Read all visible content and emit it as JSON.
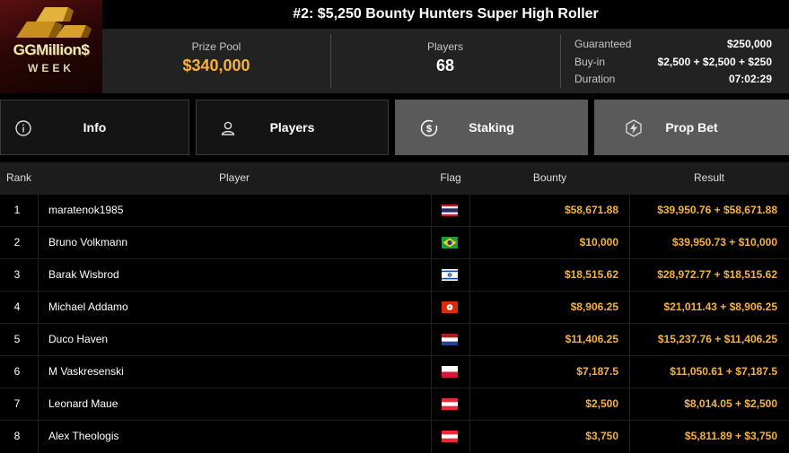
{
  "logo": {
    "line1": "GGMillion$",
    "line2": "WEEK"
  },
  "title": "#2: $5,250 Bounty Hunters Super High Roller",
  "stats": {
    "prize_pool_label": "Prize Pool",
    "prize_pool": "$340,000",
    "players_label": "Players",
    "players": "68",
    "guaranteed_label": "Guaranteed",
    "guaranteed": "$250,000",
    "buyin_label": "Buy-in",
    "buyin": "$2,500 + $2,500 + $250",
    "duration_label": "Duration",
    "duration": "07:02:29"
  },
  "tabs": [
    {
      "label": "Info",
      "icon": "info-icon"
    },
    {
      "label": "Players",
      "icon": "user-icon"
    },
    {
      "label": "Staking",
      "icon": "dollar-cycle-icon"
    },
    {
      "label": "Prop Bet",
      "icon": "lightning-icon"
    }
  ],
  "columns": {
    "rank": "Rank",
    "player": "Player",
    "flag": "Flag",
    "bounty": "Bounty",
    "result": "Result"
  },
  "rows": [
    {
      "rank": "1",
      "player": "maratenok1985",
      "flag": "thailand-flag",
      "bounty": "$58,671.88",
      "result": "$39,950.76 + $58,671.88"
    },
    {
      "rank": "2",
      "player": "Bruno Volkmann",
      "flag": "brazil-flag",
      "bounty": "$10,000",
      "result": "$39,950.73 + $10,000"
    },
    {
      "rank": "3",
      "player": "Barak Wisbrod",
      "flag": "israel-flag",
      "bounty": "$18,515.62",
      "result": "$28,972.77 + $18,515.62"
    },
    {
      "rank": "4",
      "player": "Michael Addamo",
      "flag": "hong-kong-flag",
      "bounty": "$8,906.25",
      "result": "$21,011.43 + $8,906.25"
    },
    {
      "rank": "5",
      "player": "Duco Haven",
      "flag": "netherlands-flag",
      "bounty": "$11,406.25",
      "result": "$15,237.76 + $11,406.25"
    },
    {
      "rank": "6",
      "player": "M Vaskresenski",
      "flag": "poland-flag",
      "bounty": "$7,187.5",
      "result": "$11,050.61 + $7,187.5"
    },
    {
      "rank": "7",
      "player": "Leonard Maue",
      "flag": "austria-flag",
      "bounty": "$2,500",
      "result": "$8,014.05 + $2,500"
    },
    {
      "rank": "8",
      "player": "Alex Theologis",
      "flag": "austria-flag",
      "bounty": "$3,750",
      "result": "$5,811.89 + $3,750"
    }
  ],
  "colors": {
    "accent_gold": "#f5b23e",
    "active_tab": "#5a5a5a",
    "panel": "#222222"
  }
}
